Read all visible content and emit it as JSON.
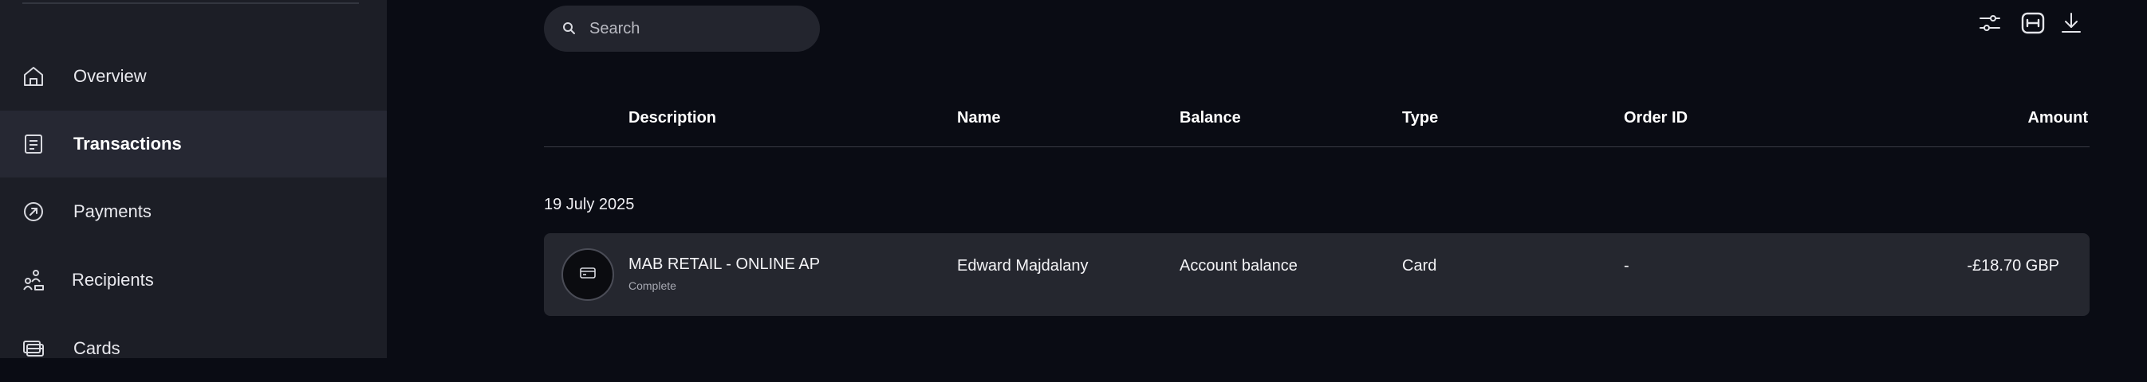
{
  "sidebar": {
    "items": [
      {
        "label": "Overview",
        "icon": "home-icon",
        "active": false
      },
      {
        "label": "Transactions",
        "icon": "receipt-icon",
        "active": true
      },
      {
        "label": "Payments",
        "icon": "arrow-up-right-circle-icon",
        "active": false
      },
      {
        "label": "Recipients",
        "icon": "recipients-icon",
        "active": false
      },
      {
        "label": "Cards",
        "icon": "cards-icon",
        "active": false
      }
    ]
  },
  "toolbar": {
    "search_placeholder": "Search",
    "filter_icon": "sliders-icon",
    "columns_icon": "columns-icon",
    "download_icon": "download-icon"
  },
  "table": {
    "columns": [
      "Description",
      "Name",
      "Balance",
      "Type",
      "Order ID",
      "Amount"
    ],
    "groups": [
      {
        "date": "19 July 2025",
        "rows": [
          {
            "description": "MAB RETAIL - ONLINE AP",
            "status": "Complete",
            "name": "Edward Majdalany",
            "balance": "Account balance",
            "type": "Card",
            "order_id": "-",
            "amount": "-£18.70 GBP",
            "icon": "card-icon"
          }
        ]
      }
    ]
  },
  "colors": {
    "sidebar_bg": "#1c1e26",
    "sidebar_active_bg": "#262833",
    "main_bg": "#0a0c14",
    "row_bg": "#25272f",
    "search_bg": "#23252e"
  }
}
